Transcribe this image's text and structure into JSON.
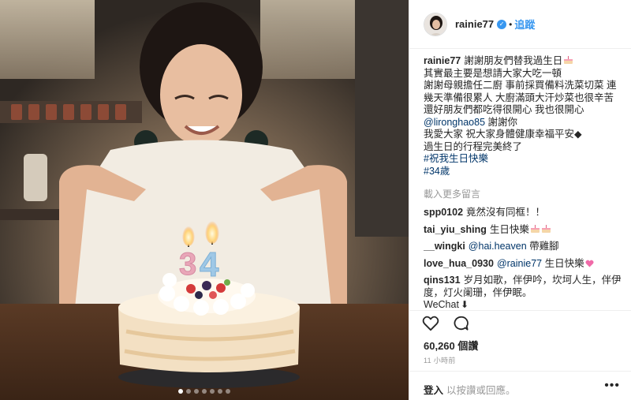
{
  "header": {
    "username": "rainie77",
    "separator": "•",
    "follow_label": "追蹤",
    "verified_icon": "✓"
  },
  "caption": {
    "username": "rainie77",
    "line1": "謝謝朋友們替我過生日",
    "line2": "其實最主要是想請大家大吃一頓",
    "line3": "謝謝母親擔任二廚 事前採買備料洗菜切菜 連",
    "line4": "幾天準備很累人 大廚滿頭大汗炒菜也很辛苦",
    "line5": "還好朋友們都吃得很開心 我也很開心",
    "mention": "@lironghao85",
    "line6_rest": " 謝謝你",
    "line7": "我愛大家 祝大家身體健康幸福平安◆",
    "line8": "過生日的行程完美終了",
    "tag1": "#祝我生日快樂",
    "tag2": "#34歲"
  },
  "load_more": "載入更多留言",
  "comments": [
    {
      "user": "spp0102",
      "text": "竟然沒有同框！！"
    },
    {
      "user": "tai_yiu_shing",
      "text": "生日快樂"
    },
    {
      "user": "__wingki",
      "mention": "@hai.heaven",
      "text": " 帶雞腳"
    },
    {
      "user": "love_hua_0930",
      "mention": "@rainie77",
      "text": " 生日快樂"
    },
    {
      "user": "qins131",
      "text": "岁月如歌，伴伊吟，坎坷人生，伴伊度，灯火阑珊，伴伊眠。"
    }
  ],
  "wechat_text": "WeChat",
  "likes": "60,260 個讚",
  "timestamp": "11 小時前",
  "login": {
    "link": "登入",
    "rest": "以按讚或回應。"
  },
  "more_label": "•••",
  "carousel": {
    "count": 7,
    "active": 0
  },
  "colors": {
    "link": "#003569",
    "accent": "#3897f0",
    "muted": "#999999",
    "text": "#262626"
  },
  "icons": [
    "verified-icon",
    "heart-icon",
    "comment-icon",
    "cake-emoji-icon",
    "pink-heart-emoji-icon",
    "down-arrow-icon",
    "more-options-icon"
  ]
}
